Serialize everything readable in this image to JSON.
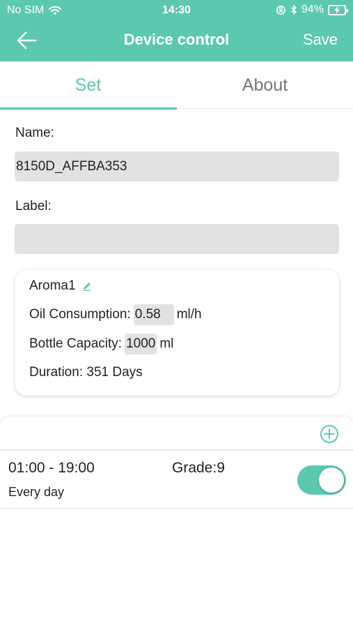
{
  "status_bar": {
    "carrier": "No SIM",
    "time": "14:30",
    "battery_percent": "94%"
  },
  "navbar": {
    "title": "Device control",
    "save_label": "Save"
  },
  "tabs": [
    {
      "label": "Set",
      "active": true
    },
    {
      "label": "About",
      "active": false
    }
  ],
  "form": {
    "name_label": "Name:",
    "name_value": "8150D_AFFBA353",
    "label_label": "Label:",
    "label_value": ""
  },
  "aroma": {
    "title": "Aroma1",
    "oil_label": "Oil Consumption:",
    "oil_value": "0.58",
    "oil_unit": "ml/h",
    "bottle_label": "Bottle Capacity:",
    "bottle_value": "1000",
    "bottle_unit": "ml",
    "duration_text": "Duration: 351 Days"
  },
  "schedule": [
    {
      "time_range": "01:00 - 19:00",
      "grade": "Grade:9",
      "repeat": "Every day",
      "enabled": true
    }
  ],
  "colors": {
    "accent": "#5cc8b0",
    "input_bg": "#e2e2e2"
  }
}
